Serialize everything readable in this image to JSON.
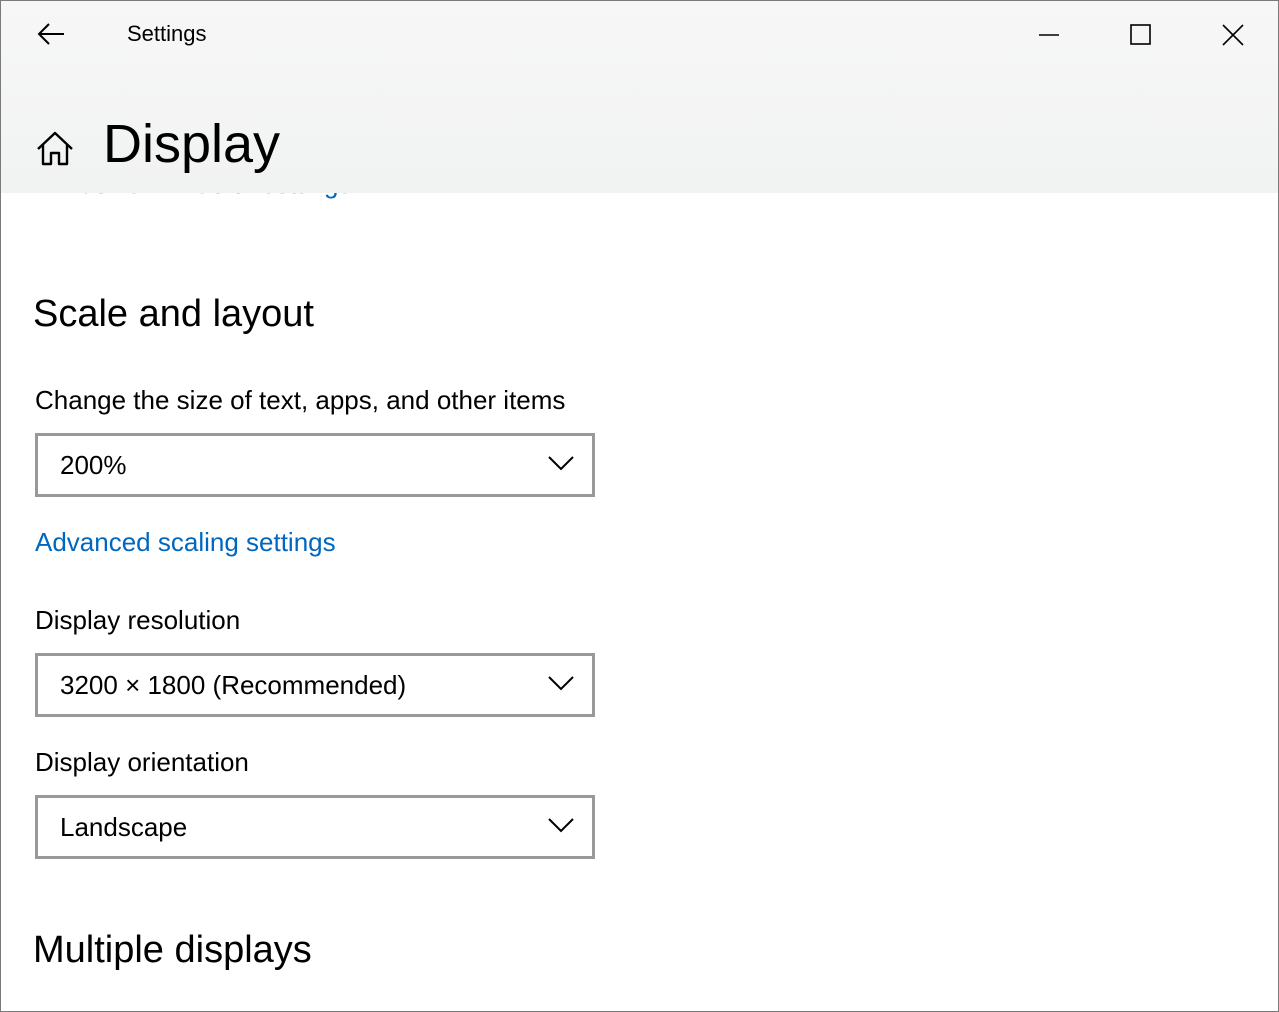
{
  "window": {
    "app_title": "Settings",
    "minimize_icon": "minimize-icon",
    "maximize_icon": "maximize-icon",
    "close_icon": "close-icon",
    "back_icon": "back-arrow-icon"
  },
  "header": {
    "home_icon": "home-icon",
    "page_title": "Display"
  },
  "content": {
    "hd_color_link": "Windows HD Color settings",
    "scale_section": {
      "title": "Scale and layout",
      "size_label": "Change the size of text, apps, and other items",
      "size_value": "200%",
      "advanced_link": "Advanced scaling settings",
      "resolution_label": "Display resolution",
      "resolution_value": "3200 × 1800 (Recommended)",
      "orientation_label": "Display orientation",
      "orientation_value": "Landscape"
    },
    "multiple_section": {
      "title": "Multiple displays"
    }
  },
  "colors": {
    "link": "#0067c0",
    "header_bg": "#f3f3f3",
    "dropdown_border": "#999999"
  }
}
